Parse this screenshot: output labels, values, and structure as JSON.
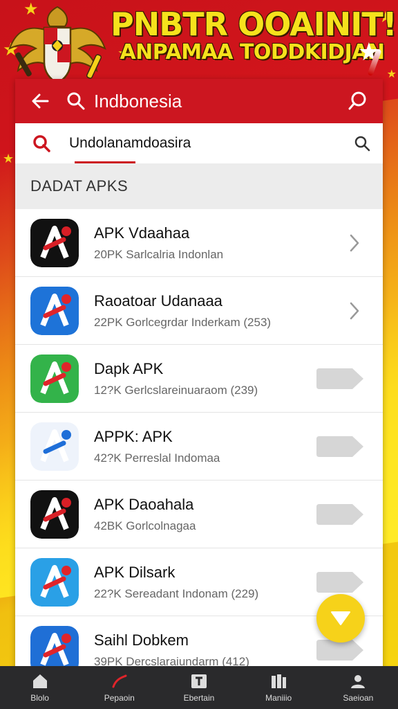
{
  "banner": {
    "title": "PNBTR OOAINIT!I",
    "subtitle": "ANPAMAA TODDKIDJAN"
  },
  "appbar": {
    "back_icon": "arrow-left-icon",
    "search_icon": "search-icon",
    "title": "Indbonesia",
    "action_icon": "search-icon"
  },
  "search": {
    "query": "Undolanamdoasira",
    "icon": "search-icon"
  },
  "section": {
    "title": "DADAT APKS"
  },
  "apps": [
    {
      "name": "APK Vdaahaa",
      "meta": "20PK Sarlcalria Indonlan",
      "trailing": "chevron",
      "icon_colors": [
        "#111111",
        "#d81f26"
      ]
    },
    {
      "name": "Raoatoar Udanaaa",
      "meta": "22PK Gorlcegrdar Inderkam (253)",
      "trailing": "chevron",
      "icon_colors": [
        "#1e73d8",
        "#e0242a"
      ]
    },
    {
      "name": "Dapk APK",
      "meta": "12?K Gerlcslareinuaraom (239)",
      "trailing": "tag",
      "icon_colors": [
        "#33b34a",
        "#e0242a"
      ]
    },
    {
      "name": "APPK: APK",
      "meta": "42?K Perreslal Indomaa",
      "trailing": "tag",
      "icon_colors": [
        "#eef3fb",
        "#1e6ed8"
      ]
    },
    {
      "name": "APK Daoahala",
      "meta": "42BK Gorlcolnagaa",
      "trailing": "tag",
      "icon_colors": [
        "#111111",
        "#d81f26"
      ]
    },
    {
      "name": "APK Dilsark",
      "meta": "22?K Sereadant Indonam (229)",
      "trailing": "tag",
      "icon_colors": [
        "#2aa0e6",
        "#e0242a"
      ]
    },
    {
      "name": "Saihl Dobkem",
      "meta": "39PK Dercslaraiundarm (412)",
      "trailing": "tag",
      "icon_colors": [
        "#1f6fd6",
        "#e0242a"
      ]
    }
  ],
  "fab": {
    "icon": "chevron-down-icon",
    "color": "#f6d21a"
  },
  "bottom_nav": [
    {
      "label": "Blolo",
      "icon": "home-icon"
    },
    {
      "label": "Pepaoin",
      "icon": "explore-icon"
    },
    {
      "label": "Ebertain",
      "icon": "text-icon"
    },
    {
      "label": "Maniiio",
      "icon": "library-icon"
    },
    {
      "label": "Saeioan",
      "icon": "profile-icon"
    }
  ],
  "colors": {
    "accent": "#cc1620",
    "yellow": "#f6d21a"
  }
}
